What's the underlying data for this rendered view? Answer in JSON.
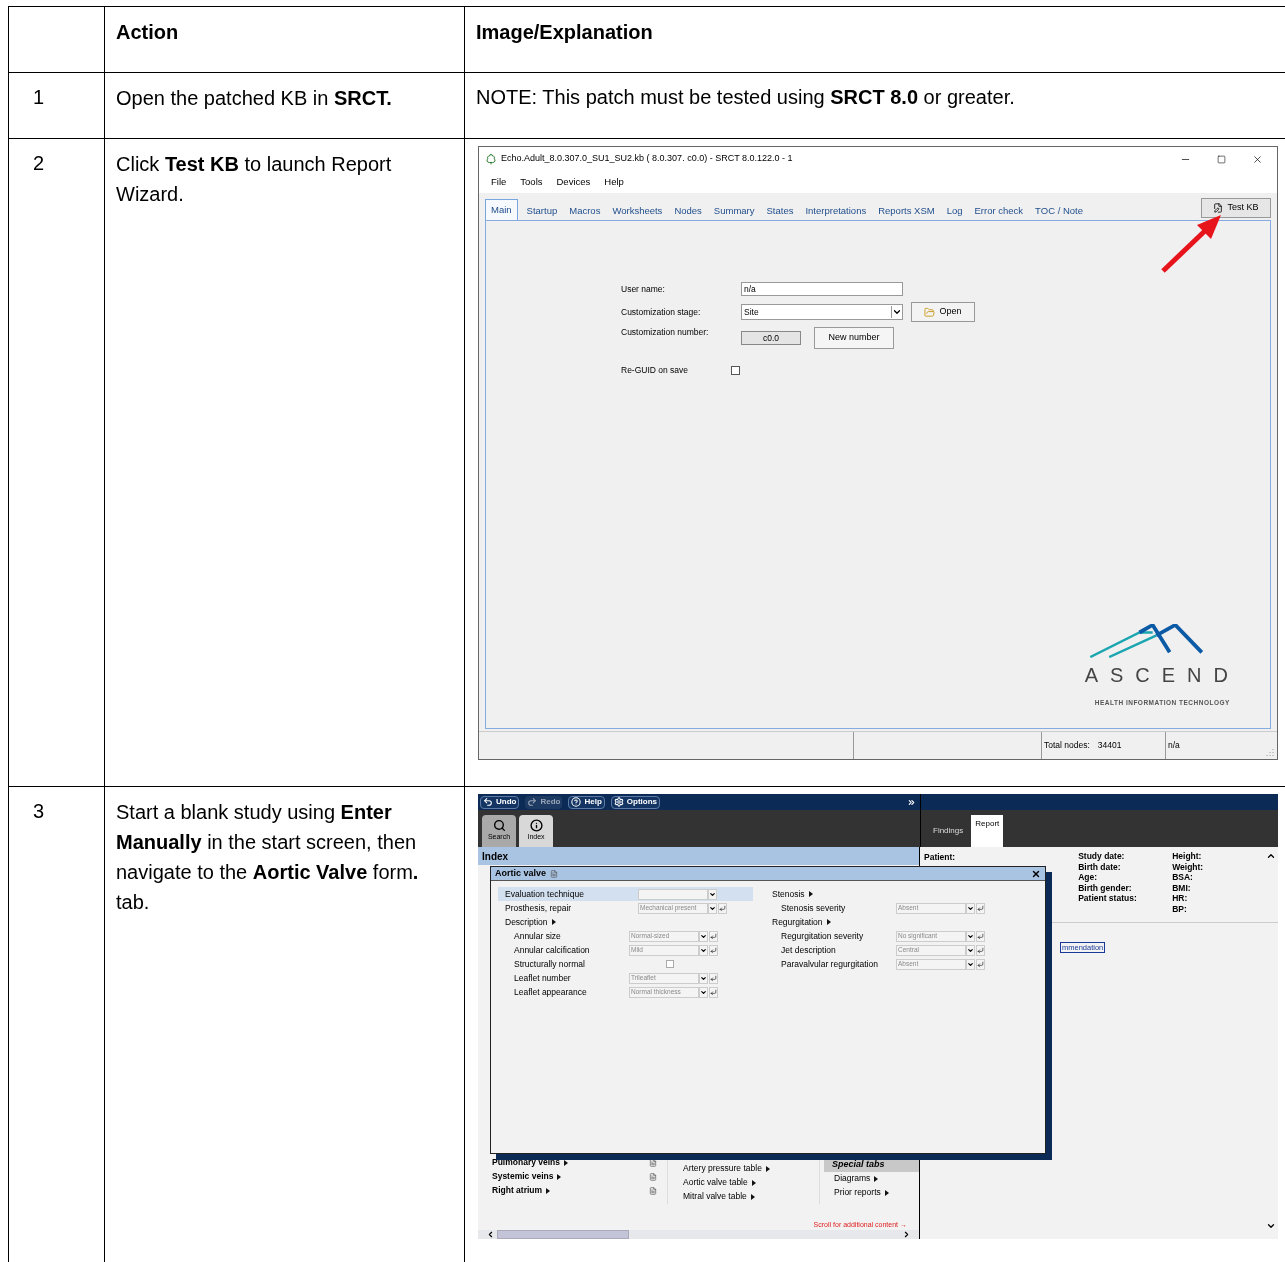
{
  "table": {
    "columns": [
      "Action",
      "Image/Explanation"
    ],
    "rows": [
      {
        "kind": "note",
        "step": "1",
        "action": "Open the patched KB in **SRCT.**",
        "note": "NOTE: This patch must be tested using  **SRCT 8.0** or greater."
      },
      {
        "kind": "srct",
        "step": "2",
        "action": "Click **Test KB** to launch Report Wizard.",
        "window": {
          "title": "Echo.Adult_8.0.307.0_SU1_SU2.kb ( 8.0.307. c0.0) - SRCT 8.0.122.0 - 1",
          "menu": [
            "File",
            "Tools",
            "Devices",
            "Help"
          ],
          "tabs": [
            {
              "label": "Main",
              "selected": true
            },
            {
              "label": "Startup",
              "selected": false
            },
            {
              "label": "Macros",
              "selected": false
            },
            {
              "label": "Worksheets",
              "selected": false
            },
            {
              "label": "Nodes",
              "selected": false
            },
            {
              "label": "Summary",
              "selected": false
            },
            {
              "label": "States",
              "selected": false
            },
            {
              "label": "Interpretations",
              "selected": false
            },
            {
              "label": "Reports XSM",
              "selected": false
            },
            {
              "label": "Log",
              "selected": false
            },
            {
              "label": "Error check",
              "selected": false
            },
            {
              "label": "TOC / Note",
              "selected": false
            }
          ],
          "test_button": "Test KB",
          "user_name": {
            "label": "User name:",
            "value": "n/a"
          },
          "stage": {
            "label": "Customization stage:",
            "value": "Site",
            "button": "Open"
          },
          "number": {
            "label": "Customization number:",
            "value": "c0.0",
            "button": "New number"
          },
          "reguid": {
            "label": "Re-GUID on save",
            "checked": false
          },
          "logo": {
            "wordmark": "ASCEND",
            "tagline": "HEALTH INFORMATION TECHNOLOGY"
          },
          "status": {
            "label": "Total nodes:",
            "count": "34401",
            "user": "n/a"
          }
        }
      },
      {
        "kind": "wizard",
        "step": "3",
        "action": "Start a blank study using **Enter Manually** in the start screen, then navigate to the **Aortic Valve** form**.** tab.",
        "wizard": {
          "toolbar": [
            {
              "label": "Undo",
              "disabled": false
            },
            {
              "label": "Redo",
              "disabled": true
            },
            {
              "label": "Help",
              "disabled": false
            },
            {
              "label": "Options",
              "disabled": false
            }
          ],
          "side_tabs": [
            {
              "label": "Search",
              "selected": false
            },
            {
              "label": "Index",
              "selected": true
            }
          ],
          "report_tabs": [
            {
              "label": "Findings",
              "selected": false
            },
            {
              "label": "Report",
              "selected": true
            }
          ],
          "index_title": "Index",
          "patient_label": "Patient:",
          "patient_fields": [
            [
              "Study date:",
              "Birth date:",
              "Age:",
              "Birth gender:",
              "Patient status:"
            ],
            [
              "Height:",
              "Weight:",
              "BSA:",
              "BMI:",
              "HR:",
              "BP:"
            ]
          ],
          "link_fragment": "mmendation",
          "dialog": {
            "title": "Aortic valve",
            "left": [
              {
                "kind": "select",
                "label": "Evaluation technique",
                "selected": true
              },
              {
                "kind": "select",
                "label": "Prosthesis, repair",
                "value": "Mechanical present",
                "selected": false
              },
              {
                "kind": "section",
                "label": "Description",
                "selected": false,
                "children": [
                  {
                    "kind": "select",
                    "label": "Annular size",
                    "value": "Normal-sized",
                    "selected": false
                  },
                  {
                    "kind": "select",
                    "label": "Annular calcification",
                    "value": "Mild",
                    "selected": false
                  },
                  {
                    "kind": "checkbox",
                    "label": "Structurally normal",
                    "checked": false,
                    "selected": false
                  },
                  {
                    "kind": "select",
                    "label": "Leaflet number",
                    "value": "Trileaflet",
                    "selected": false
                  },
                  {
                    "kind": "select",
                    "label": "Leaflet appearance",
                    "value": "Normal thickness",
                    "selected": false
                  }
                ]
              }
            ],
            "right": [
              {
                "kind": "section",
                "label": "Stenosis",
                "selected": false,
                "children": [
                  {
                    "kind": "select",
                    "label": "Stenosis severity",
                    "value": "Absent",
                    "selected": false
                  }
                ]
              },
              {
                "kind": "section",
                "label": "Regurgitation",
                "selected": false,
                "children": [
                  {
                    "kind": "select",
                    "label": "Regurgitation severity",
                    "value": "No significant",
                    "selected": false
                  },
                  {
                    "kind": "select",
                    "label": "Jet description",
                    "value": "Central",
                    "selected": false
                  },
                  {
                    "kind": "select",
                    "label": "Paravalvular regurgitation",
                    "value": "Absent",
                    "selected": false
                  }
                ]
              }
            ]
          },
          "index_groups": [
            "Pulmonary veins",
            "Systemic veins",
            "Right atrium"
          ],
          "index_tables": [
            "Artery pressure table",
            "Aortic valve table",
            "Mitral valve table"
          ],
          "special_tabs": {
            "title": "Special tabs",
            "items": [
              "Diagrams",
              "Prior reports"
            ]
          },
          "scroll_hint": "Scroll for additional content →"
        }
      }
    ]
  }
}
